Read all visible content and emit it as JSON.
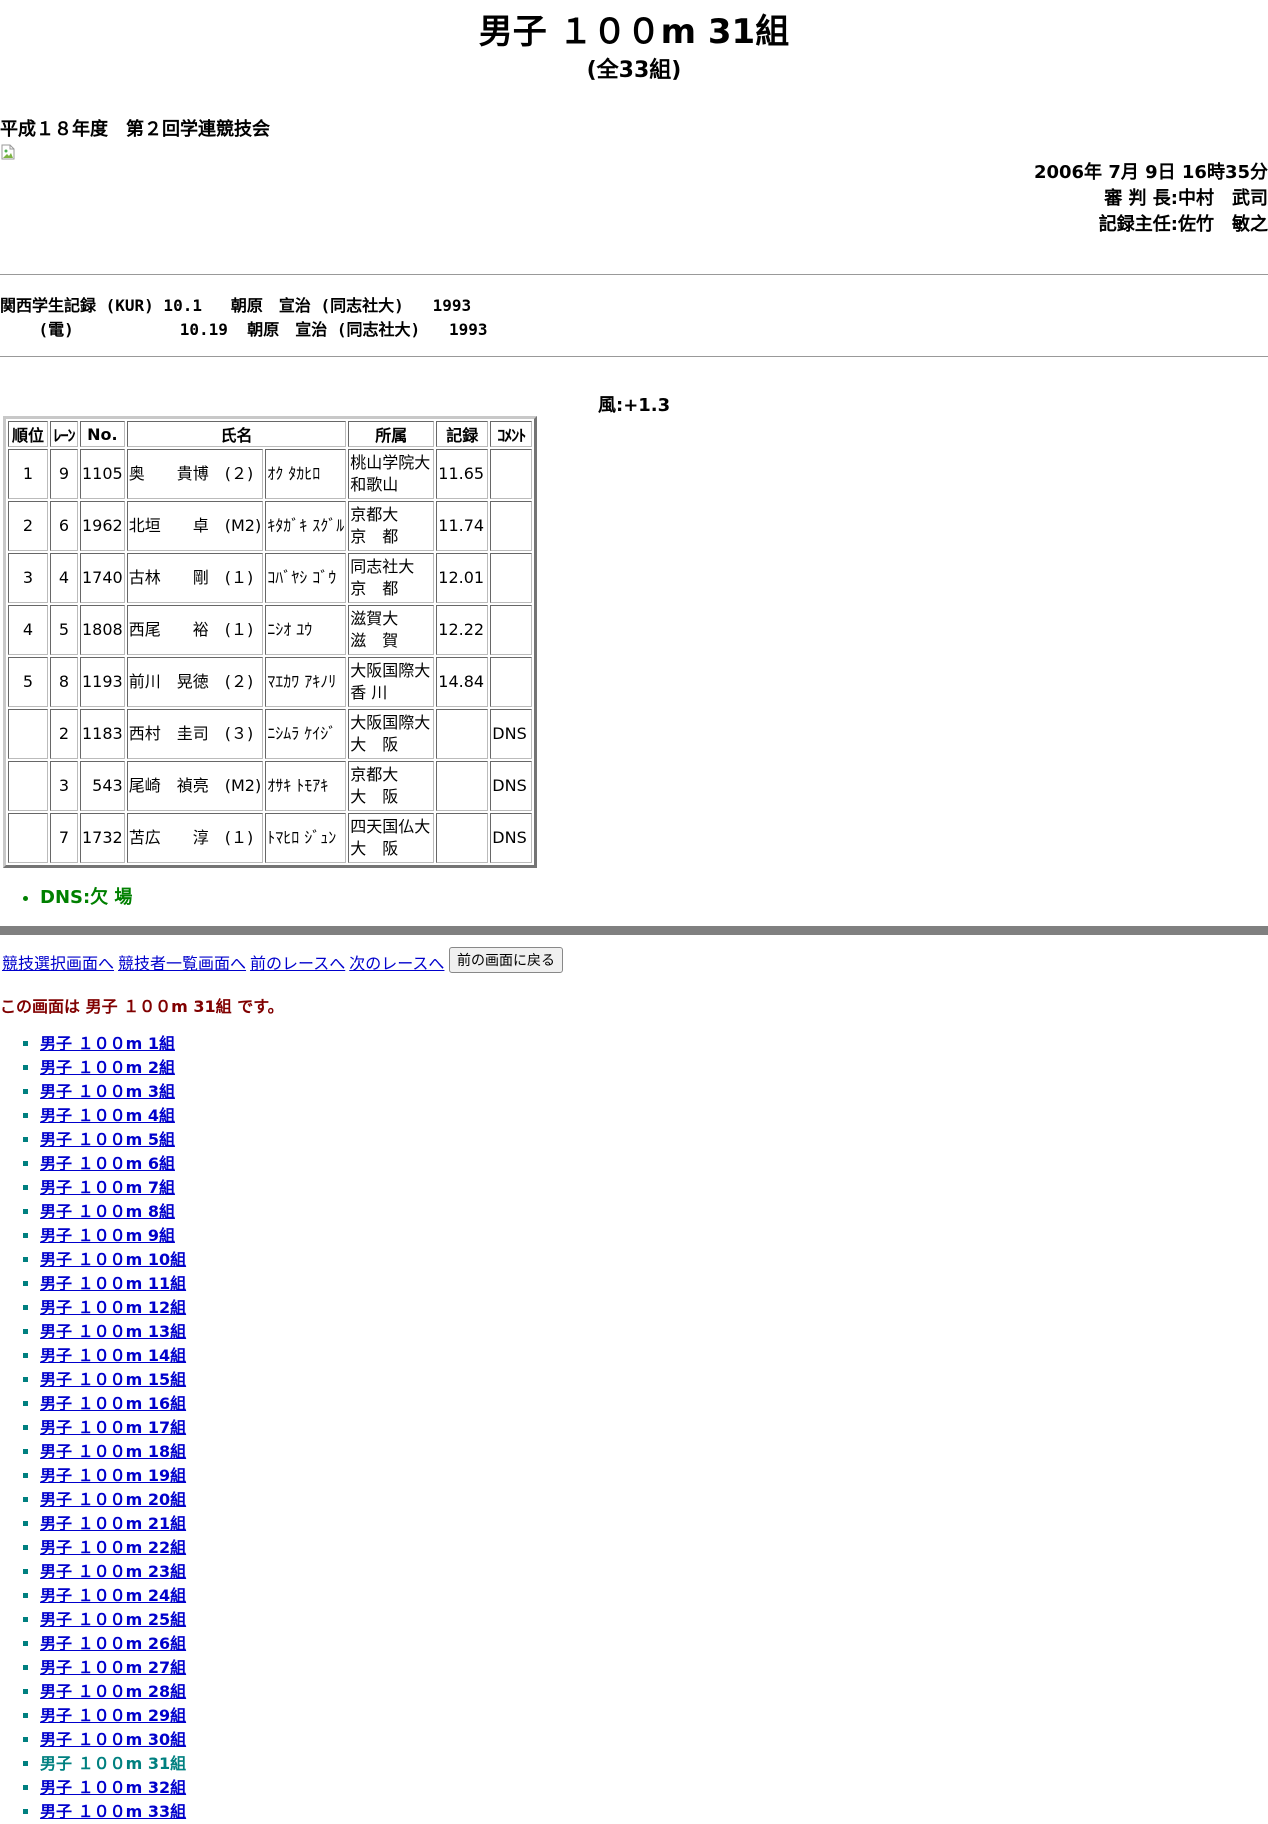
{
  "header": {
    "title": "男子 １００m 31組",
    "subtitle": "(全33組)",
    "meet_name": "平成１８年度　第２回学連競技会",
    "datetime": "2006年 7月 9日 16時35分",
    "referee": "審 判 長:中村　武司",
    "recorder": "記録主任:佐竹　敏之"
  },
  "records": {
    "line1": "関西学生記録 (KUR) 10.1   朝原　宣治 (同志社大)   1993",
    "line2": "    (電)           10.19  朝原　宣治 (同志社大)   1993"
  },
  "wind": "風:+1.3",
  "results": {
    "headers": [
      "順位",
      "ﾚｰﾝ",
      "No.",
      "氏名",
      "所属",
      "記録",
      "ｺﾒﾝﾄ"
    ],
    "rows": [
      {
        "rank": "1",
        "lane": "9",
        "no": "1105",
        "name": "奥　　貴博　(２)",
        "kana": "ｵｸ ﾀｶﾋﾛ",
        "team": "桃山学院大",
        "pref": "和歌山",
        "time": "11.65",
        "comment": ""
      },
      {
        "rank": "2",
        "lane": "6",
        "no": "1962",
        "name": "北垣　　卓　(M2)",
        "kana": "ｷﾀｶﾞｷ ｽｸﾞﾙ",
        "team": "京都大",
        "pref": "京　都",
        "time": "11.74",
        "comment": ""
      },
      {
        "rank": "3",
        "lane": "4",
        "no": "1740",
        "name": "古林　　剛　(１)",
        "kana": "ｺﾊﾞﾔｼ ｺﾞｳ",
        "team": "同志社大",
        "pref": "京　都",
        "time": "12.01",
        "comment": ""
      },
      {
        "rank": "4",
        "lane": "5",
        "no": "1808",
        "name": "西尾　　裕　(１)",
        "kana": "ﾆｼｵ ﾕｳ",
        "team": "滋賀大",
        "pref": "滋　賀",
        "time": "12.22",
        "comment": ""
      },
      {
        "rank": "5",
        "lane": "8",
        "no": "1193",
        "name": "前川　晃徳　(２)",
        "kana": "ﾏｴｶﾜ ｱｷﾉﾘ",
        "team": "大阪国際大",
        "pref": "香 川",
        "time": "14.84",
        "comment": ""
      },
      {
        "rank": "",
        "lane": "2",
        "no": "1183",
        "name": "西村　圭司　(３)",
        "kana": "ﾆｼﾑﾗ ｹｲｼﾞ",
        "team": "大阪国際大",
        "pref": "大　阪",
        "time": "",
        "comment": "DNS"
      },
      {
        "rank": "",
        "lane": "3",
        "no": "543",
        "name": "尾崎　禎亮　(M2)",
        "kana": "ｵｻｷ ﾄﾓｱｷ",
        "team": "京都大",
        "pref": "大　阪",
        "time": "",
        "comment": "DNS"
      },
      {
        "rank": "",
        "lane": "7",
        "no": "1732",
        "name": "苫広　　淳　(１)",
        "kana": "ﾄﾏﾋﾛ ｼﾞｭﾝ",
        "team": "四天国仏大",
        "pref": "大　阪",
        "time": "",
        "comment": "DNS"
      }
    ]
  },
  "legend": "DNS:欠 場",
  "nav": {
    "event_select": "競技選択画面へ",
    "athlete_list": "競技者一覧画面へ",
    "prev_race": "前のレースへ",
    "next_race": "次のレースへ",
    "back_button": "前の画面に戻る"
  },
  "current_screen": "この画面は 男子 １００m 31組 です。",
  "races": [
    "男子 １００m 1組",
    "男子 １００m 2組",
    "男子 １００m 3組",
    "男子 １００m 4組",
    "男子 １００m 5組",
    "男子 １００m 6組",
    "男子 １００m 7組",
    "男子 １００m 8組",
    "男子 １００m 9組",
    "男子 １００m 10組",
    "男子 １００m 11組",
    "男子 １００m 12組",
    "男子 １００m 13組",
    "男子 １００m 14組",
    "男子 １００m 15組",
    "男子 １００m 16組",
    "男子 １００m 17組",
    "男子 １００m 18組",
    "男子 １００m 19組",
    "男子 １００m 20組",
    "男子 １００m 21組",
    "男子 １００m 22組",
    "男子 １００m 23組",
    "男子 １００m 24組",
    "男子 １００m 25組",
    "男子 １００m 26組",
    "男子 １００m 27組",
    "男子 １００m 28組",
    "男子 １００m 29組",
    "男子 １００m 30組",
    "男子 １００m 31組",
    "男子 １００m 32組",
    "男子 １００m 33組"
  ],
  "current_race_index": 30
}
